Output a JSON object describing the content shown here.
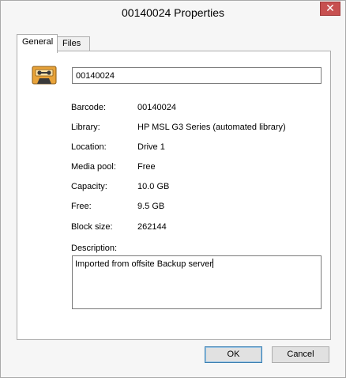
{
  "window": {
    "title": "00140024 Properties",
    "close_glyph": "✕"
  },
  "tabs": [
    {
      "label": "General",
      "active": true
    },
    {
      "label": "Files",
      "active": false
    }
  ],
  "media": {
    "icon": "tape-cartridge-icon",
    "name_value": "00140024"
  },
  "fields": [
    {
      "label": "Barcode:",
      "value": "00140024"
    },
    {
      "label": "Library:",
      "value": "HP MSL G3 Series (automated library)"
    },
    {
      "label": "Location:",
      "value": "Drive 1"
    },
    {
      "label": "Media pool:",
      "value": "Free"
    },
    {
      "label": "Capacity:",
      "value": "10.0 GB"
    },
    {
      "label": "Free:",
      "value": "9.5 GB"
    },
    {
      "label": "Block size:",
      "value": "262144"
    }
  ],
  "description": {
    "label": "Description:",
    "value": "Imported from offsite Backup server"
  },
  "buttons": {
    "ok_label": "OK",
    "cancel_label": "Cancel"
  },
  "colors": {
    "close": "#c75050",
    "icon_orange": "#e8a33a",
    "icon_dark": "#3a3a3a",
    "default_button_border": "#3c7fb1"
  }
}
